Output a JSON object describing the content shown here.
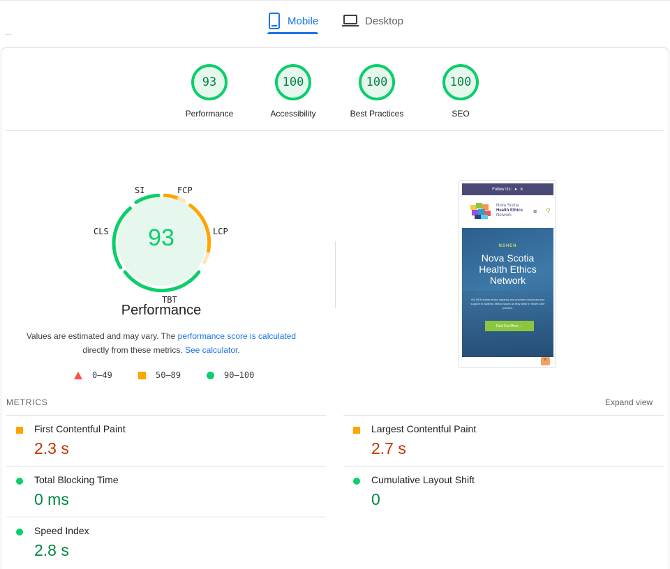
{
  "tabs": [
    {
      "label": "Mobile",
      "icon": "mobile-phone-icon",
      "active": true
    },
    {
      "label": "Desktop",
      "icon": "laptop-icon",
      "active": false
    }
  ],
  "categories": [
    {
      "score": "93",
      "label": "Performance"
    },
    {
      "score": "100",
      "label": "Accessibility"
    },
    {
      "score": "100",
      "label": "Best Practices"
    },
    {
      "score": "100",
      "label": "SEO"
    }
  ],
  "performance": {
    "score": "93",
    "title": "Performance",
    "gauge_labels": {
      "si": "SI",
      "fcp": "FCP",
      "lcp": "LCP",
      "tbt": "TBT",
      "cls": "CLS"
    },
    "disclaimer_prefix": "Values are estimated and may vary. The ",
    "disclaimer_link1": "performance score is calculated",
    "disclaimer_middle": " directly from these metrics. ",
    "disclaimer_link2": "See calculator",
    "disclaimer_suffix": "."
  },
  "legend": [
    {
      "range": "0–49",
      "shape": "triangle",
      "color": "#ff4e42"
    },
    {
      "range": "50–89",
      "shape": "square",
      "color": "#ffa400"
    },
    {
      "range": "90–100",
      "shape": "circle",
      "color": "#0cce6b"
    }
  ],
  "screenshot": {
    "topbar": "Follow Us:",
    "brand_line1": "Nova Scotia",
    "brand_line2": "Health Ethics",
    "brand_line3": "Network",
    "kicker": "NSHEN",
    "title_line1": "Nova Scotia",
    "title_line2": "Health Ethics",
    "title_line3": "Network",
    "body": "NS-HEN builds ethics capacity and provides resources and support to address ethics issues as they arise in health care practice.",
    "button": "Find Out More →"
  },
  "metrics": {
    "heading": "METRICS",
    "expand": "Expand view",
    "items": [
      {
        "name": "First Contentful Paint",
        "value": "2.3 s",
        "status": "average"
      },
      {
        "name": "Largest Contentful Paint",
        "value": "2.7 s",
        "status": "average"
      },
      {
        "name": "Total Blocking Time",
        "value": "0 ms",
        "status": "good"
      },
      {
        "name": "Cumulative Layout Shift",
        "value": "0",
        "status": "good"
      },
      {
        "name": "Speed Index",
        "value": "2.8 s",
        "status": "good"
      }
    ]
  },
  "colors": {
    "accent": "#1a73e8",
    "good": "#0cce6b",
    "average": "#ffa400",
    "poor": "#ff4e42"
  }
}
